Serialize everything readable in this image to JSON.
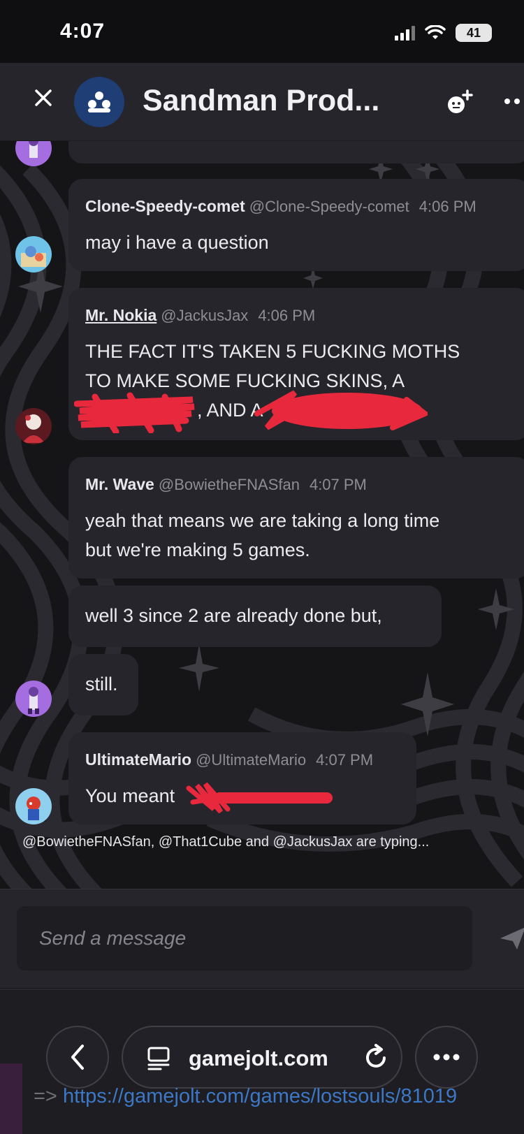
{
  "status_bar": {
    "time": "4:07",
    "battery": "41"
  },
  "header": {
    "title": "Sandman Prod...",
    "close_icon": "close-icon",
    "group_icon": "group-icon",
    "add_member_icon": "add-member-icon",
    "more_icon": "more-icon"
  },
  "messages": [
    {
      "username": "Clone-Speedy-comet",
      "handle": "@Clone-Speedy-comet",
      "time": "4:06 PM",
      "lines": [
        "may i have a question"
      ]
    },
    {
      "username": "Mr. Nokia",
      "handle": "@JackusJax",
      "time": "4:06 PM",
      "lines": [
        "THE FACT IT'S TAKEN 5 FUCKING MOTHS",
        "TO MAKE SOME FUCKING SKINS, A",
        ", AND A"
      ]
    },
    {
      "username": "Mr. Wave",
      "handle": "@BowietheFNASfan",
      "time": "4:07 PM",
      "lines": [
        "yeah that means we are taking a long time",
        "but we're making 5 games."
      ],
      "followups": [
        "well 3 since 2 are already done but,",
        "still."
      ]
    },
    {
      "username": "UltimateMario",
      "handle": "@UltimateMario",
      "time": "4:07 PM",
      "lines": [
        "You meant"
      ]
    }
  ],
  "typing_indicator": "@BowietheFNASfan, @That1Cube and @JackusJax are typing...",
  "composer": {
    "placeholder": "Send a message"
  },
  "browser": {
    "domain": "gamejolt.com"
  },
  "link_overlay": {
    "arrow": "=>",
    "url": "https://gamejolt.com/games/lostsouls/81019"
  },
  "colors": {
    "bubble": "#26252b",
    "background": "#151417",
    "link": "#3c78c6",
    "redaction": "#e8283c"
  }
}
